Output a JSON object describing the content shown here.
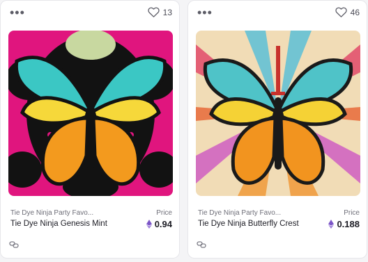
{
  "cards": [
    {
      "menu_glyph": "•••",
      "favorite_icon": "heart-outline-icon",
      "favorites": "13",
      "collection": "Tie Dye Ninja Party Favo...",
      "name": "Tie Dye Ninja Genesis Mint",
      "price_label": "Price",
      "price": "0.94",
      "currency_icon": "ethereum-icon",
      "footer_icon": "chain-link-icon",
      "palette": {
        "background": "#e0157e",
        "dark": "#121212",
        "wing_top": "#3bc7c4",
        "wing_mid": "#f6d83a",
        "wing_low": "#f39a1e"
      }
    },
    {
      "menu_glyph": "•••",
      "favorite_icon": "heart-outline-icon",
      "favorites": "46",
      "collection": "Tie Dye Ninja Party Favo...",
      "name": "Tie Dye Ninja Butterfly Crest",
      "price_label": "Price",
      "price": "0.188",
      "currency_icon": "ethereum-icon",
      "footer_icon": "chain-link-icon",
      "palette": {
        "background": "#f1dcb6",
        "dark": "#1a1a1a",
        "wing_top": "#4fc3c8",
        "wing_mid": "#f5d235",
        "wing_low": "#f2941f"
      }
    }
  ]
}
